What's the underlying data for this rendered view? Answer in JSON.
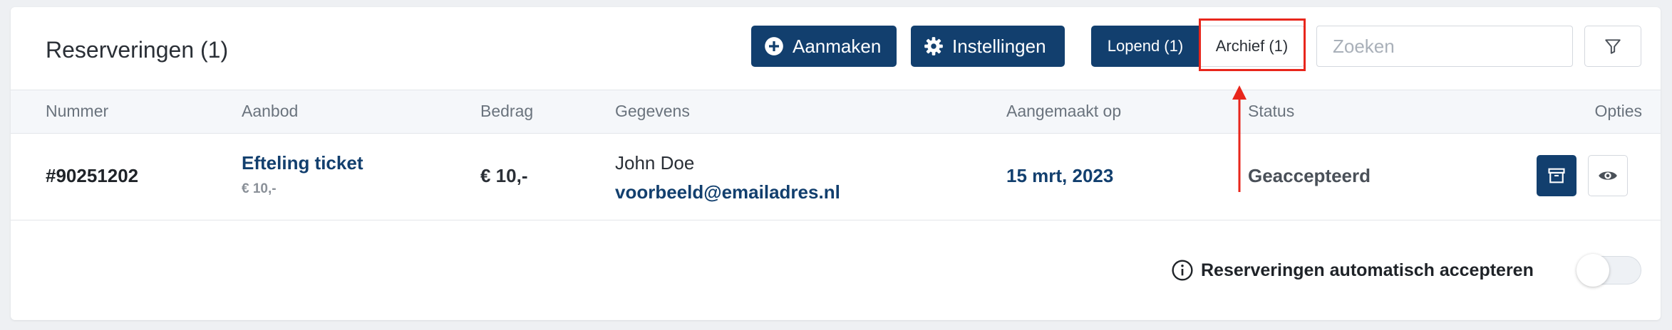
{
  "header": {
    "title": "Reserveringen (1)",
    "create_label": "Aanmaken",
    "settings_label": "Instellingen",
    "tabs": [
      {
        "label": "Lopend (1)",
        "active": true
      },
      {
        "label": "Archief (1)",
        "active": false
      }
    ],
    "search_placeholder": "Zoeken"
  },
  "table": {
    "columns": [
      "Nummer",
      "Aanbod",
      "Bedrag",
      "Gegevens",
      "Aangemaakt op",
      "Status",
      "Opties"
    ],
    "rows": [
      {
        "number": "#90251202",
        "offer_name": "Efteling ticket",
        "offer_price": "€ 10,-",
        "amount": "€ 10,-",
        "customer_name": "John Doe",
        "customer_email": "voorbeeld@emailadres.nl",
        "created_at": "15 mrt, 2023",
        "status": "Geaccepteerd"
      }
    ]
  },
  "footer": {
    "auto_accept_label": "Reserveringen automatisch accepteren",
    "auto_accept_enabled": false
  },
  "colors": {
    "primary": "#123f6e",
    "highlight": "#e8261c",
    "background": "#eef0f3"
  },
  "icons": {
    "create": "plus-circle-icon",
    "settings": "gear-icon",
    "filter": "filter-icon",
    "archive": "archive-icon",
    "view": "eye-icon",
    "info": "info-icon"
  }
}
